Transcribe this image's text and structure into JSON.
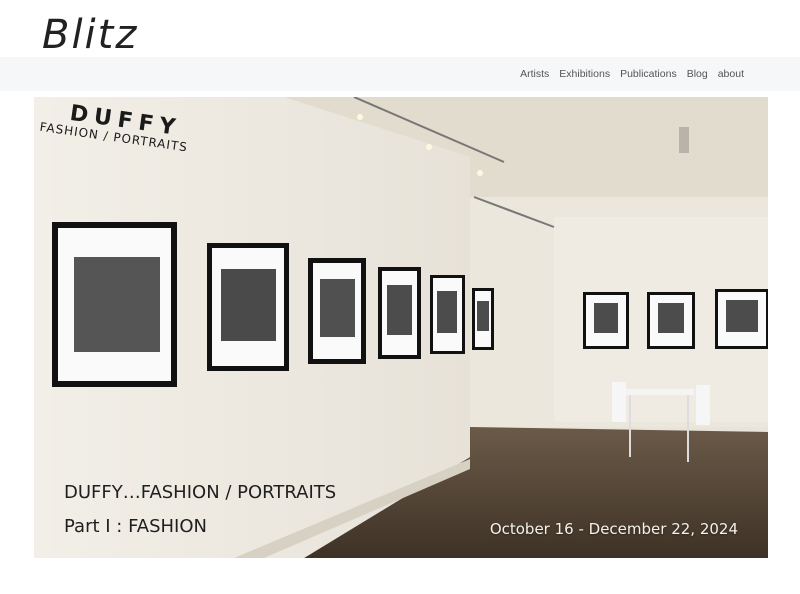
{
  "brand": {
    "logo": "Blitz"
  },
  "nav": {
    "items": [
      "Artists",
      "Exhibitions",
      "Publications",
      "Blog",
      "about"
    ]
  },
  "hero": {
    "wall_title": "DUFFY",
    "wall_subtitle": "FASHION / PORTRAITS",
    "title_line1": "DUFFY…FASHION / PORTRAITS",
    "title_line2": "Part I : FASHION",
    "dates": "October 16 - December 22, 2024"
  }
}
